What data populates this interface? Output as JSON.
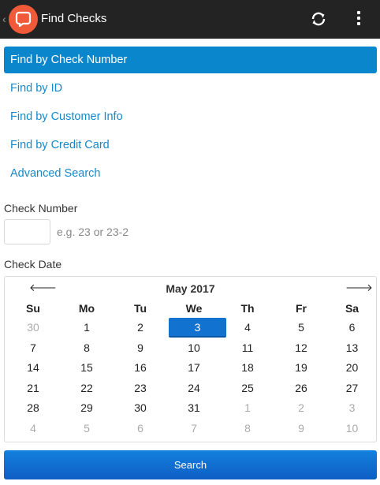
{
  "appbar": {
    "title": "Find Checks",
    "back_glyph": "‹",
    "icons": [
      "back-chevron-icon",
      "app-logo-icon",
      "refresh-icon",
      "overflow-menu-icon"
    ],
    "logo_color": "#f05a38",
    "background": "#232323"
  },
  "nav": {
    "items": [
      {
        "label": "Find by Check Number",
        "active": true
      },
      {
        "label": "Find by ID",
        "active": false
      },
      {
        "label": "Find by Customer Info",
        "active": false
      },
      {
        "label": "Find by Credit Card",
        "active": false
      },
      {
        "label": "Advanced Search",
        "active": false
      }
    ],
    "accent_color": "#0a86cd"
  },
  "form": {
    "check_number_label": "Check Number",
    "check_number_value": "",
    "check_number_placeholder": "e.g. 23 or 23-2",
    "check_date_label": "Check Date"
  },
  "calendar": {
    "month_label": "May 2017",
    "prev_glyph": "🡐",
    "next_glyph": "🡒",
    "weekdays": [
      "Su",
      "Mo",
      "Tu",
      "We",
      "Th",
      "Fr",
      "Sa"
    ],
    "selected_day": "3",
    "weeks": [
      [
        {
          "d": "30",
          "m": true
        },
        {
          "d": "1"
        },
        {
          "d": "2"
        },
        {
          "d": "3",
          "s": true
        },
        {
          "d": "4"
        },
        {
          "d": "5"
        },
        {
          "d": "6"
        }
      ],
      [
        {
          "d": "7"
        },
        {
          "d": "8"
        },
        {
          "d": "9"
        },
        {
          "d": "10"
        },
        {
          "d": "11"
        },
        {
          "d": "12"
        },
        {
          "d": "13"
        }
      ],
      [
        {
          "d": "14"
        },
        {
          "d": "15"
        },
        {
          "d": "16"
        },
        {
          "d": "17"
        },
        {
          "d": "18"
        },
        {
          "d": "19"
        },
        {
          "d": "20"
        }
      ],
      [
        {
          "d": "21"
        },
        {
          "d": "22"
        },
        {
          "d": "23"
        },
        {
          "d": "24"
        },
        {
          "d": "25"
        },
        {
          "d": "26"
        },
        {
          "d": "27"
        }
      ],
      [
        {
          "d": "28"
        },
        {
          "d": "29"
        },
        {
          "d": "30"
        },
        {
          "d": "31"
        },
        {
          "d": "1",
          "m": true
        },
        {
          "d": "2",
          "m": true
        },
        {
          "d": "3",
          "m": true
        }
      ],
      [
        {
          "d": "4",
          "m": true
        },
        {
          "d": "5",
          "m": true
        },
        {
          "d": "6",
          "m": true
        },
        {
          "d": "7",
          "m": true
        },
        {
          "d": "8",
          "m": true
        },
        {
          "d": "9",
          "m": true
        },
        {
          "d": "10",
          "m": true
        }
      ]
    ],
    "selected_color": "#1272d0"
  },
  "search_button": {
    "label": "Search"
  }
}
